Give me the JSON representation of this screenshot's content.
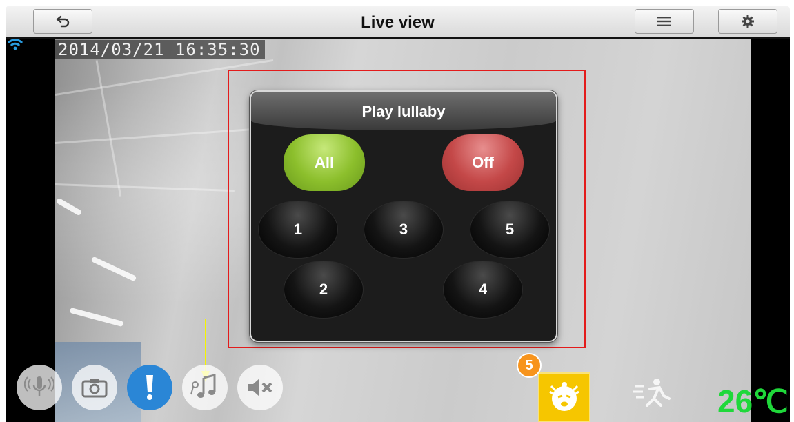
{
  "app": {
    "title": "Live view"
  },
  "camera": {
    "timestamp": "2014/03/21 16:35:30",
    "temperature": "26℃"
  },
  "dialog": {
    "title": "Play lullaby",
    "all_label": "All",
    "off_label": "Off",
    "tracks": [
      "1",
      "2",
      "3",
      "4",
      "5"
    ]
  },
  "badge": {
    "count": "5"
  },
  "icons": {
    "back": "back-arrow-icon",
    "menu": "menu-icon",
    "settings": "gear-icon",
    "wifi": "wifi-icon",
    "mic": "microphone-icon",
    "camera": "camera-icon",
    "alert": "alert-icon",
    "lullaby": "music-note-icon",
    "mute": "speaker-mute-icon",
    "baby": "crying-baby-icon",
    "motion": "motion-icon"
  },
  "colors": {
    "highlight": "#e31b1b",
    "all_button": "#8cbf2c",
    "off_button": "#c44848",
    "alert_button": "#2a86d6",
    "badge": "#f7941d",
    "baby_button": "#f6c600",
    "temperature": "#1fd83a",
    "arrow": "#f5f500"
  }
}
